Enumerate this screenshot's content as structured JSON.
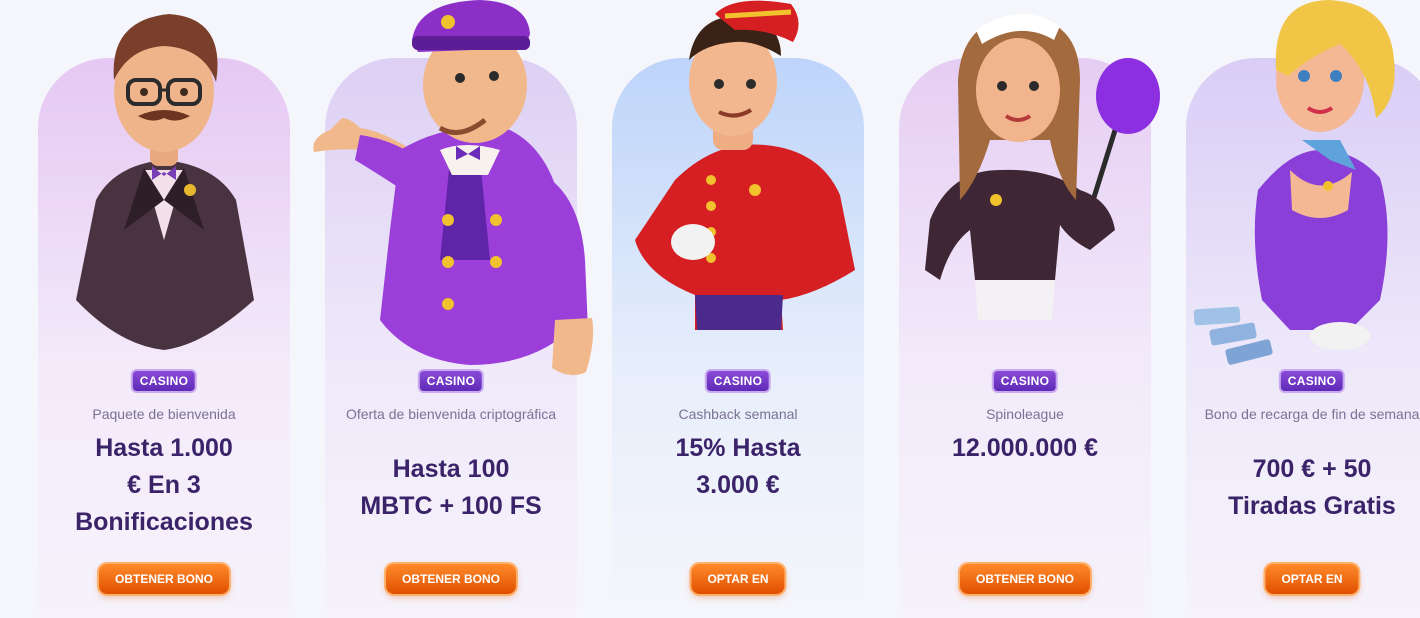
{
  "offers": [
    {
      "badge": "CASINO",
      "subtitle": "Paquete de bienvenida",
      "amount_lines": [
        "Hasta 1.000",
        "€ En 3",
        "Bonificaciones"
      ],
      "cta": "OBTENER BONO",
      "theme": "#e8d4f3"
    },
    {
      "badge": "CASINO",
      "subtitle": "Oferta de bienvenida criptográfica",
      "amount_lines": [
        "Hasta 100",
        "MBTC + 100 FS"
      ],
      "cta": "OBTENER BONO",
      "theme": "#e2d6f7"
    },
    {
      "badge": "CASINO",
      "subtitle": "Cashback semanal",
      "amount_lines": [
        "15% Hasta",
        "3.000 €"
      ],
      "cta": "OPTAR EN",
      "theme": "#cfe0fb"
    },
    {
      "badge": "CASINO",
      "subtitle": "Spinoleague",
      "amount_lines": [
        "12.000.000 €"
      ],
      "cta": "OBTENER BONO",
      "theme": "#ead6f5"
    },
    {
      "badge": "CASINO",
      "subtitle": "Bono de recarga de fin de semana",
      "amount_lines": [
        "700 € + 50",
        "Tiradas Gratis"
      ],
      "cta": "OPTAR EN",
      "theme": "#ddd3f7"
    }
  ],
  "colors": {
    "accent_orange": "#f26a10",
    "badge_purple": "#6b33c2",
    "heading": "#3a2368"
  },
  "icons": [
    "butler-character",
    "doorman-character",
    "bellboy-character",
    "maid-character",
    "hostess-character"
  ]
}
